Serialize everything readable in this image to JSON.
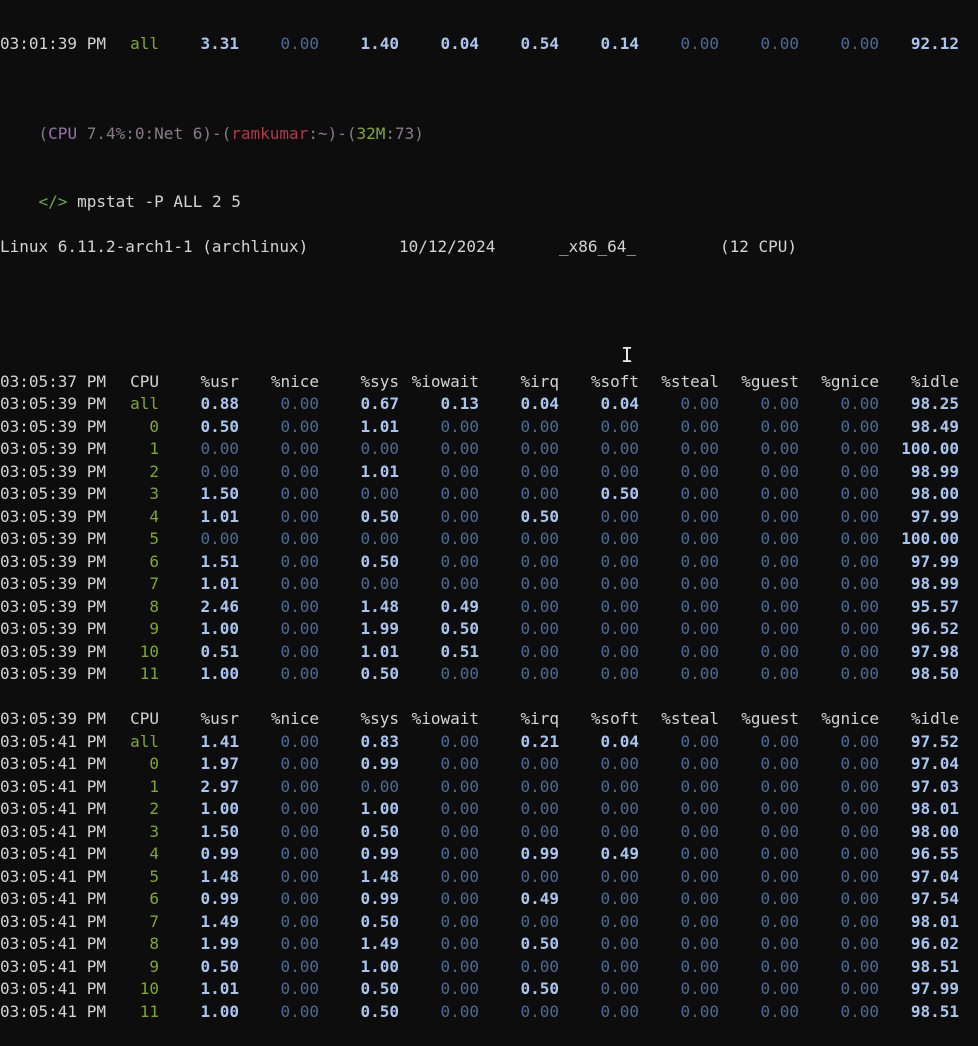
{
  "top_partial_line": {
    "time": "03:01:39 PM",
    "cpu": "all",
    "values": [
      "3.31",
      "0.00",
      "1.40",
      "0.04",
      "0.54",
      "0.14",
      "0.00",
      "0.00",
      "0.00",
      "92.12"
    ]
  },
  "prompt": {
    "open": "(",
    "cpu_label": "CPU",
    "cpu_value": "7.4%",
    "sep1": ":",
    "zero": "0",
    "sep2": ":",
    "net": "Net 6",
    "close1": ")-(",
    "user": "ramkumar",
    "path": ":~",
    "close2": ")-(",
    "mem": "32M",
    "sep3": ":",
    "count": "73",
    "close3": ")"
  },
  "command": {
    "symbol": "</>",
    "text": "mpstat -P ALL 2 5"
  },
  "sysinfo": {
    "kernel": "Linux 6.11.2-arch1-1 (archlinux)",
    "date": "10/12/2024",
    "arch": "_x86_64_",
    "cpus": "(12 CPU)"
  },
  "columns": [
    "CPU",
    "%usr",
    "%nice",
    "%sys",
    "%iowait",
    "%irq",
    "%soft",
    "%steal",
    "%guest",
    "%gnice",
    "%idle"
  ],
  "blocks": [
    {
      "header_time": "03:05:37 PM",
      "rows": [
        {
          "time": "03:05:39 PM",
          "cpu": "all",
          "v": [
            "0.88",
            "0.00",
            "0.67",
            "0.13",
            "0.04",
            "0.04",
            "0.00",
            "0.00",
            "0.00",
            "98.25"
          ]
        },
        {
          "time": "03:05:39 PM",
          "cpu": "0",
          "v": [
            "0.50",
            "0.00",
            "1.01",
            "0.00",
            "0.00",
            "0.00",
            "0.00",
            "0.00",
            "0.00",
            "98.49"
          ]
        },
        {
          "time": "03:05:39 PM",
          "cpu": "1",
          "v": [
            "0.00",
            "0.00",
            "0.00",
            "0.00",
            "0.00",
            "0.00",
            "0.00",
            "0.00",
            "0.00",
            "100.00"
          ]
        },
        {
          "time": "03:05:39 PM",
          "cpu": "2",
          "v": [
            "0.00",
            "0.00",
            "1.01",
            "0.00",
            "0.00",
            "0.00",
            "0.00",
            "0.00",
            "0.00",
            "98.99"
          ]
        },
        {
          "time": "03:05:39 PM",
          "cpu": "3",
          "v": [
            "1.50",
            "0.00",
            "0.00",
            "0.00",
            "0.00",
            "0.50",
            "0.00",
            "0.00",
            "0.00",
            "98.00"
          ]
        },
        {
          "time": "03:05:39 PM",
          "cpu": "4",
          "v": [
            "1.01",
            "0.00",
            "0.50",
            "0.00",
            "0.50",
            "0.00",
            "0.00",
            "0.00",
            "0.00",
            "97.99"
          ]
        },
        {
          "time": "03:05:39 PM",
          "cpu": "5",
          "v": [
            "0.00",
            "0.00",
            "0.00",
            "0.00",
            "0.00",
            "0.00",
            "0.00",
            "0.00",
            "0.00",
            "100.00"
          ]
        },
        {
          "time": "03:05:39 PM",
          "cpu": "6",
          "v": [
            "1.51",
            "0.00",
            "0.50",
            "0.00",
            "0.00",
            "0.00",
            "0.00",
            "0.00",
            "0.00",
            "97.99"
          ]
        },
        {
          "time": "03:05:39 PM",
          "cpu": "7",
          "v": [
            "1.01",
            "0.00",
            "0.00",
            "0.00",
            "0.00",
            "0.00",
            "0.00",
            "0.00",
            "0.00",
            "98.99"
          ]
        },
        {
          "time": "03:05:39 PM",
          "cpu": "8",
          "v": [
            "2.46",
            "0.00",
            "1.48",
            "0.49",
            "0.00",
            "0.00",
            "0.00",
            "0.00",
            "0.00",
            "95.57"
          ]
        },
        {
          "time": "03:05:39 PM",
          "cpu": "9",
          "v": [
            "1.00",
            "0.00",
            "1.99",
            "0.50",
            "0.00",
            "0.00",
            "0.00",
            "0.00",
            "0.00",
            "96.52"
          ]
        },
        {
          "time": "03:05:39 PM",
          "cpu": "10",
          "v": [
            "0.51",
            "0.00",
            "1.01",
            "0.51",
            "0.00",
            "0.00",
            "0.00",
            "0.00",
            "0.00",
            "97.98"
          ]
        },
        {
          "time": "03:05:39 PM",
          "cpu": "11",
          "v": [
            "1.00",
            "0.00",
            "0.50",
            "0.00",
            "0.00",
            "0.00",
            "0.00",
            "0.00",
            "0.00",
            "98.50"
          ]
        }
      ]
    },
    {
      "header_time": "03:05:39 PM",
      "rows": [
        {
          "time": "03:05:41 PM",
          "cpu": "all",
          "v": [
            "1.41",
            "0.00",
            "0.83",
            "0.00",
            "0.21",
            "0.04",
            "0.00",
            "0.00",
            "0.00",
            "97.52"
          ]
        },
        {
          "time": "03:05:41 PM",
          "cpu": "0",
          "v": [
            "1.97",
            "0.00",
            "0.99",
            "0.00",
            "0.00",
            "0.00",
            "0.00",
            "0.00",
            "0.00",
            "97.04"
          ]
        },
        {
          "time": "03:05:41 PM",
          "cpu": "1",
          "v": [
            "2.97",
            "0.00",
            "0.00",
            "0.00",
            "0.00",
            "0.00",
            "0.00",
            "0.00",
            "0.00",
            "97.03"
          ]
        },
        {
          "time": "03:05:41 PM",
          "cpu": "2",
          "v": [
            "1.00",
            "0.00",
            "1.00",
            "0.00",
            "0.00",
            "0.00",
            "0.00",
            "0.00",
            "0.00",
            "98.01"
          ]
        },
        {
          "time": "03:05:41 PM",
          "cpu": "3",
          "v": [
            "1.50",
            "0.00",
            "0.50",
            "0.00",
            "0.00",
            "0.00",
            "0.00",
            "0.00",
            "0.00",
            "98.00"
          ]
        },
        {
          "time": "03:05:41 PM",
          "cpu": "4",
          "v": [
            "0.99",
            "0.00",
            "0.99",
            "0.00",
            "0.99",
            "0.49",
            "0.00",
            "0.00",
            "0.00",
            "96.55"
          ]
        },
        {
          "time": "03:05:41 PM",
          "cpu": "5",
          "v": [
            "1.48",
            "0.00",
            "1.48",
            "0.00",
            "0.00",
            "0.00",
            "0.00",
            "0.00",
            "0.00",
            "97.04"
          ]
        },
        {
          "time": "03:05:41 PM",
          "cpu": "6",
          "v": [
            "0.99",
            "0.00",
            "0.99",
            "0.00",
            "0.49",
            "0.00",
            "0.00",
            "0.00",
            "0.00",
            "97.54"
          ]
        },
        {
          "time": "03:05:41 PM",
          "cpu": "7",
          "v": [
            "1.49",
            "0.00",
            "0.50",
            "0.00",
            "0.00",
            "0.00",
            "0.00",
            "0.00",
            "0.00",
            "98.01"
          ]
        },
        {
          "time": "03:05:41 PM",
          "cpu": "8",
          "v": [
            "1.99",
            "0.00",
            "1.49",
            "0.00",
            "0.50",
            "0.00",
            "0.00",
            "0.00",
            "0.00",
            "96.02"
          ]
        },
        {
          "time": "03:05:41 PM",
          "cpu": "9",
          "v": [
            "0.50",
            "0.00",
            "1.00",
            "0.00",
            "0.00",
            "0.00",
            "0.00",
            "0.00",
            "0.00",
            "98.51"
          ]
        },
        {
          "time": "03:05:41 PM",
          "cpu": "10",
          "v": [
            "1.01",
            "0.00",
            "0.50",
            "0.00",
            "0.50",
            "0.00",
            "0.00",
            "0.00",
            "0.00",
            "97.99"
          ]
        },
        {
          "time": "03:05:41 PM",
          "cpu": "11",
          "v": [
            "1.00",
            "0.00",
            "0.50",
            "0.00",
            "0.00",
            "0.00",
            "0.00",
            "0.00",
            "0.00",
            "98.51"
          ]
        }
      ]
    }
  ],
  "colors": {
    "background": "#0d0d0d",
    "text": "#d4d4d4",
    "value_zero": "#4f6b95",
    "value_nonzero": "#a9c5f0",
    "cpu_id": "#7fa832",
    "prompt_user": "#b03a48"
  },
  "cursor_icon": "text-cursor-icon"
}
